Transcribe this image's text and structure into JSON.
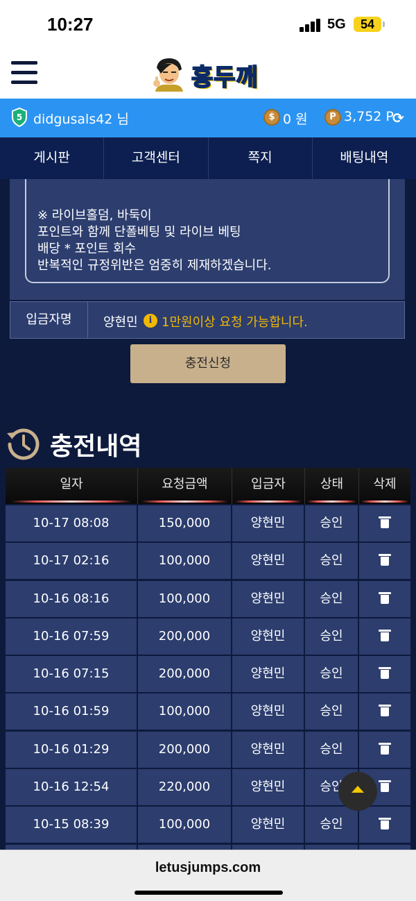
{
  "status_bar": {
    "time": "10:27",
    "network": "5G",
    "battery": "54"
  },
  "header": {
    "logo_text": "홍두깨"
  },
  "user": {
    "username": "didgusals42 님",
    "level_badge": "5",
    "coin_symbol": "$",
    "cash": "0 원",
    "point_symbol": "P",
    "points": "3,752 P"
  },
  "nav": {
    "items": [
      "게시판",
      "고객센터",
      "쪽지",
      "배팅내역"
    ]
  },
  "notice": {
    "lines": [
      "※ 라이브홀덤, 바둑이",
      "포인트와 함께 단폴베팅 및 라이브 베팅",
      "배당 * 포인트 회수",
      "반복적인 규정위반은 엄중히 제재하겠습니다."
    ]
  },
  "depositor": {
    "label": "입금자명",
    "name": "양현민",
    "info_symbol": "i",
    "hint": "1만원이상 요청 가능합니다."
  },
  "charge_button": "충전신청",
  "history": {
    "title": "충전내역",
    "columns": [
      "일자",
      "요청금액",
      "입금자",
      "상태",
      "삭제"
    ],
    "rows": [
      {
        "date": "10-17 08:08",
        "amount": "150,000",
        "depositor": "양현민",
        "status": "승인"
      },
      {
        "date": "10-17 02:16",
        "amount": "100,000",
        "depositor": "양현민",
        "status": "승인"
      },
      {
        "date": "10-16 08:16",
        "amount": "100,000",
        "depositor": "양현민",
        "status": "승인"
      },
      {
        "date": "10-16 07:59",
        "amount": "200,000",
        "depositor": "양현민",
        "status": "승인"
      },
      {
        "date": "10-16 07:15",
        "amount": "200,000",
        "depositor": "양현민",
        "status": "승인"
      },
      {
        "date": "10-16 01:59",
        "amount": "100,000",
        "depositor": "양현민",
        "status": "승인"
      },
      {
        "date": "10-16 01:29",
        "amount": "200,000",
        "depositor": "양현민",
        "status": "승인"
      },
      {
        "date": "10-16 12:54",
        "amount": "220,000",
        "depositor": "양현민",
        "status": "승인"
      },
      {
        "date": "10-15 08:39",
        "amount": "100,000",
        "depositor": "양현민",
        "status": "승인"
      }
    ]
  },
  "browser": {
    "url": "letusjumps.com"
  },
  "colors": {
    "accent_blue": "#2b94f2",
    "nav_bg": "#0d1f50",
    "page_bg": "#0e1a3c",
    "warning_yellow": "#f2b800",
    "button_tan": "#c8b08c"
  }
}
